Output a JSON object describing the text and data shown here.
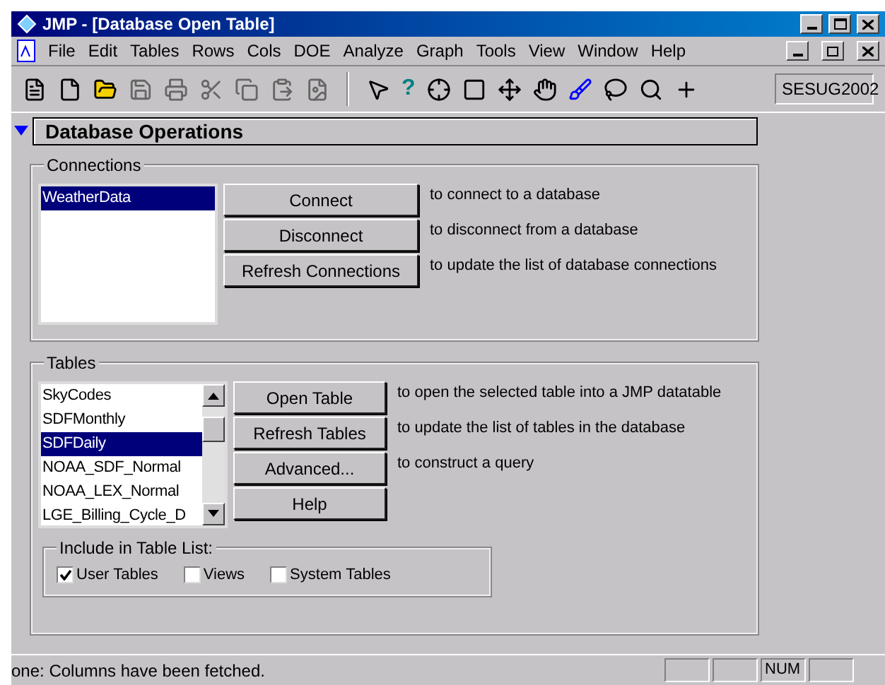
{
  "window": {
    "title": "JMP - [Database Open Table]"
  },
  "menu": [
    "File",
    "Edit",
    "Tables",
    "Rows",
    "Cols",
    "DOE",
    "Analyze",
    "Graph",
    "Tools",
    "View",
    "Window",
    "Help"
  ],
  "toolbar": {
    "help_glyph": "?",
    "database_field": "SESUG2002"
  },
  "panel": {
    "title": "Database Operations",
    "expanded": true
  },
  "connections": {
    "title": "Connections",
    "items": [
      {
        "label": "WeatherData",
        "selected": true
      }
    ],
    "buttons": [
      {
        "label": "Connect",
        "description": "to connect to a database"
      },
      {
        "label": "Disconnect",
        "description": "to disconnect from a database"
      },
      {
        "label": "Refresh Connections",
        "description": "to update the list of database connections"
      }
    ]
  },
  "tables": {
    "title": "Tables",
    "items": [
      {
        "label": "SkyCodes",
        "selected": false
      },
      {
        "label": "SDFMonthly",
        "selected": false
      },
      {
        "label": "SDFDaily",
        "selected": true
      },
      {
        "label": "NOAA_SDF_Normal",
        "selected": false
      },
      {
        "label": "NOAA_LEX_Normal",
        "selected": false
      },
      {
        "label": "LGE_Billing_Cycle_D",
        "selected": false
      }
    ],
    "buttons": [
      {
        "label": "Open Table",
        "description": "to open the selected table into a JMP datatable"
      },
      {
        "label": "Refresh Tables",
        "description": "to update the list of tables in the database"
      },
      {
        "label": "Advanced...",
        "description": "to construct a query"
      },
      {
        "label": "Help"
      }
    ],
    "include": {
      "title": "Include in Table List:",
      "options": [
        {
          "label": "User Tables",
          "checked": true
        },
        {
          "label": "Views",
          "checked": false
        },
        {
          "label": "System Tables",
          "checked": false
        }
      ]
    }
  },
  "status_bar": {
    "message": "one: Columns have been fetched.",
    "num_indicator": "NUM"
  }
}
